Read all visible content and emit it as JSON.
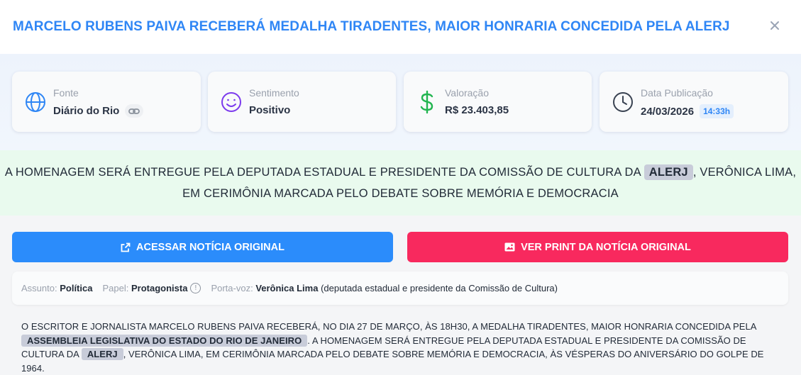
{
  "header": {
    "title": "MARCELO RUBENS PAIVA RECEBERÁ MEDALHA TIRADENTES, MAIOR HONRARIA CONCEDIDA PELA ALERJ"
  },
  "stats": {
    "source": {
      "label": "Fonte",
      "value": "Diário do Rio"
    },
    "sentiment": {
      "label": "Sentimento",
      "value": "Positivo"
    },
    "valuation": {
      "label": "Valoração",
      "value": "R$ 23.403,85"
    },
    "publication": {
      "label": "Data Publicação",
      "date": "24/03/2026",
      "time": "14:33h"
    }
  },
  "summary": {
    "part1": "A HOMENAGEM SERÁ ENTREGUE PELA DEPUTADA ESTADUAL E PRESIDENTE DA COMISSÃO DE CULTURA DA",
    "highlight": "ALERJ",
    "part2": ", VERÔNICA LIMA,",
    "line2": "EM CERIMÔNIA MARCADA PELO DEBATE SOBRE MEMÓRIA E DEMOCRACIA"
  },
  "actions": {
    "original_label": "ACESSAR NOTÍCIA ORIGINAL",
    "print_label": "VER PRINT DA NOTÍCIA ORIGINAL"
  },
  "meta": {
    "subject_key": "Assunto:",
    "subject_value": "Política",
    "role_key": "Papel:",
    "role_value": "Protagonista",
    "spokesperson_key": "Porta-voz:",
    "spokesperson_name": "Verônica Lima",
    "spokesperson_desc": "(deputada estadual e presidente da Comissão de Cultura)"
  },
  "article": {
    "t1": "O ESCRITOR E JORNALISTA MARCELO RUBENS PAIVA RECEBERÁ, NO DIA 27 DE MARÇO, ÀS 18H30, A MEDALHA TIRADENTES, MAIOR HONRARIA CONCEDIDA PELA",
    "h1": "ASSEMBLEIA LEGISLATIVA DO ESTADO DO RIO  DE JANEIRO",
    "t2": ". A HOMENAGEM SERÁ ENTREGUE PELA DEPUTADA ESTADUAL E PRESIDENTE DA COMISSÃO DE CULTURA DA",
    "h2": "ALERJ",
    "t3": ", VERÔNICA LIMA, EM CERIMÔNIA MARCADA PELO DEBATE SOBRE MEMÓRIA E DEMOCRACIA, ÀS VÉSPERAS DO ANIVERSÁRIO DO GOLPE DE 1964."
  },
  "colors": {
    "accent_blue": "#2f86f5",
    "button_blue": "#2b8cfb",
    "button_pink": "#f8295e",
    "sentiment_purple": "#7c3aed",
    "money_green": "#22b550",
    "summary_bg": "#e9faee"
  },
  "icons": {
    "close": "close-icon",
    "source": "globe-icon",
    "source_link": "link-icon",
    "sentiment": "smile-icon",
    "valuation": "dollar-icon",
    "publication": "clock-icon",
    "original": "external-link-icon",
    "print": "image-icon",
    "info": "info-icon"
  }
}
